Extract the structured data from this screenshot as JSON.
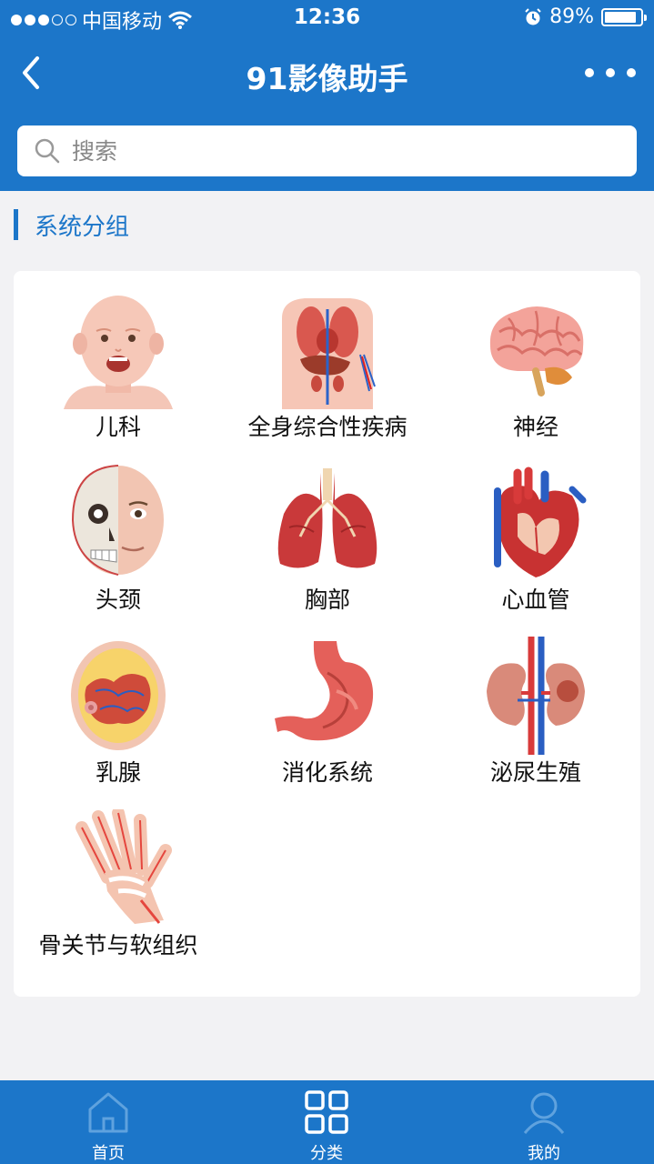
{
  "status_bar": {
    "carrier": "中国移动",
    "time": "12:36",
    "battery_percent": "89%",
    "battery_level": 0.89
  },
  "nav": {
    "title": "91影像助手",
    "back_icon": "chevron-left-icon",
    "more_icon": "more-horizontal-icon"
  },
  "search": {
    "placeholder": "搜索",
    "value": ""
  },
  "section": {
    "title": "系统分组"
  },
  "categories": [
    {
      "label": "儿科",
      "icon": "child-face-icon"
    },
    {
      "label": "全身综合性疾病",
      "icon": "body-organs-icon"
    },
    {
      "label": "神经",
      "icon": "brain-icon"
    },
    {
      "label": "头颈",
      "icon": "head-skull-icon"
    },
    {
      "label": "胸部",
      "icon": "lungs-icon"
    },
    {
      "label": "心血管",
      "icon": "heart-icon"
    },
    {
      "label": "乳腺",
      "icon": "breast-icon"
    },
    {
      "label": "消化系统",
      "icon": "stomach-icon"
    },
    {
      "label": "泌尿生殖",
      "icon": "kidney-icon"
    },
    {
      "label": "骨关节与软组织",
      "icon": "hand-bones-icon"
    }
  ],
  "tabbar": {
    "items": [
      {
        "label": "首页",
        "icon": "home-icon",
        "active": false
      },
      {
        "label": "分类",
        "icon": "grid-icon",
        "active": true
      },
      {
        "label": "我的",
        "icon": "user-icon",
        "active": false
      }
    ]
  },
  "colors": {
    "primary": "#1c76c9",
    "background": "#f2f2f4",
    "tab_inactive": "#5fa2de",
    "tab_active": "#ffffff"
  }
}
